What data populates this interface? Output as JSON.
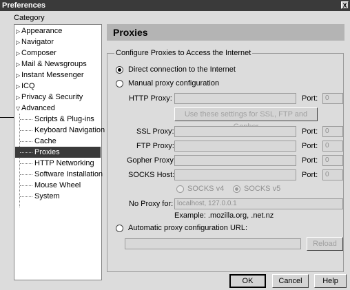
{
  "window": {
    "title": "Preferences",
    "close_glyph": "X"
  },
  "sidebar": {
    "label": "Category",
    "items": [
      {
        "label": "Appearance",
        "arrow": "▷"
      },
      {
        "label": "Navigator",
        "arrow": "▷"
      },
      {
        "label": "Composer",
        "arrow": "▷"
      },
      {
        "label": "Mail & Newsgroups",
        "arrow": "▷"
      },
      {
        "label": "Instant Messenger",
        "arrow": "▷"
      },
      {
        "label": "ICQ",
        "arrow": "▷"
      },
      {
        "label": "Privacy & Security",
        "arrow": "▷"
      },
      {
        "label": "Advanced",
        "arrow": "▽"
      }
    ],
    "children": [
      "Scripts & Plug-ins",
      "Keyboard Navigation",
      "Cache",
      "Proxies",
      "HTTP Networking",
      "Software Installation",
      "Mouse Wheel",
      "System"
    ],
    "selected": "Proxies"
  },
  "panel": {
    "title": "Proxies",
    "group_label": "Configure Proxies to Access the Internet",
    "direct_label": "Direct connection to the Internet",
    "manual_label": "Manual proxy configuration",
    "http_label": "HTTP Proxy:",
    "port_label": "Port:",
    "port_value": "0",
    "same_settings_label": "Use these settings for SSL, FTP and Gopher",
    "ssl_label": "SSL Proxy:",
    "ftp_label": "FTP Proxy:",
    "gopher_label": "Gopher Proxy:",
    "socks_label": "SOCKS Host:",
    "socks_v4": "SOCKS v4",
    "socks_v5": "SOCKS v5",
    "noproxy_label": "No Proxy for:",
    "noproxy_value": "localhost, 127.0.0.1",
    "example": "Example: .mozilla.org, .net.nz",
    "auto_label": "Automatic proxy configuration URL:",
    "reload_label": "Reload"
  },
  "buttons": {
    "ok": "OK",
    "cancel": "Cancel",
    "help": "Help"
  }
}
